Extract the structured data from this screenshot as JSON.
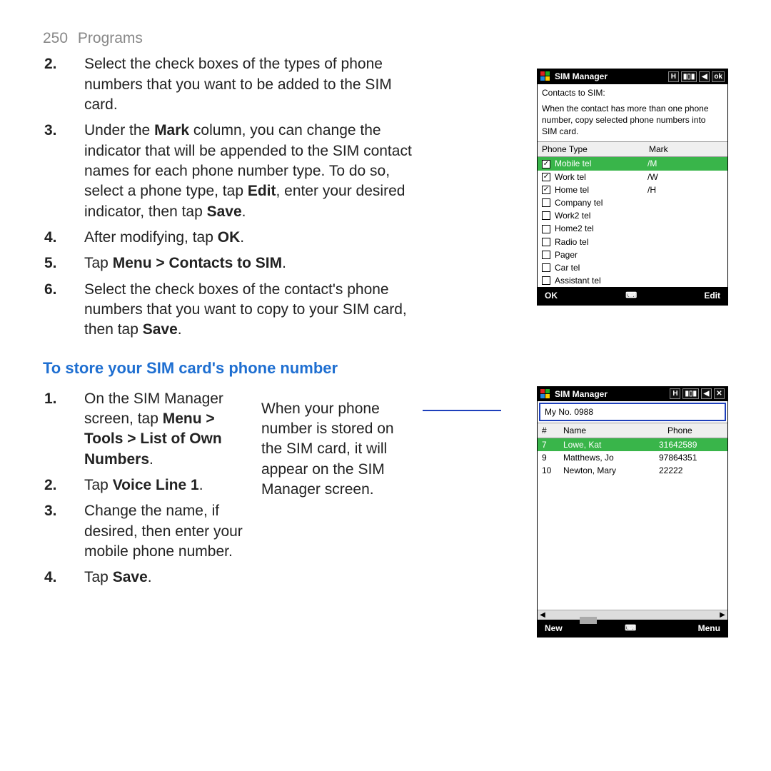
{
  "header": {
    "page_number": "250",
    "chapter": "Programs"
  },
  "steps_top": {
    "s2": {
      "n": "2.",
      "text_a": "Select the check boxes of the types of phone numbers that you want to be added to the SIM card."
    },
    "s3": {
      "n": "3.",
      "text_a": "Under the ",
      "b1": "Mark",
      "text_b": " column, you can change the indicator that will be appended to the SIM contact names for each phone number type. To do so, select a phone type, tap ",
      "b2": "Edit",
      "text_c": ", enter your desired indicator, then tap ",
      "b3": "Save",
      "text_d": "."
    },
    "s4": {
      "n": "4.",
      "text_a": "After modifying, tap ",
      "b1": "OK",
      "text_b": "."
    },
    "s5": {
      "n": "5.",
      "text_a": "Tap ",
      "b1": "Menu > Contacts to SIM",
      "text_b": "."
    },
    "s6": {
      "n": "6.",
      "text_a": "Select the check boxes of the contact's phone numbers that you want to copy to your SIM card, then tap ",
      "b1": "Save",
      "text_b": "."
    }
  },
  "section_h": "To store your SIM card's phone number",
  "steps_low": {
    "s1": {
      "n": "1.",
      "text_a": "On the SIM Manager screen, tap ",
      "b1": "Menu > Tools > List of Own Numbers",
      "text_b": "."
    },
    "s2": {
      "n": "2.",
      "text_a": "Tap ",
      "b1": "Voice Line 1",
      "text_b": "."
    },
    "s3": {
      "n": "3.",
      "text_a": "Change the name, if desired, then enter your mobile phone number."
    },
    "s4": {
      "n": "4.",
      "text_a": "Tap ",
      "b1": "Save",
      "text_b": "."
    }
  },
  "mid_note": "When your phone number is stored on the SIM card, it will appear on the SIM Manager screen.",
  "phone1": {
    "title": "SIM Manager",
    "icons": {
      "h": "H",
      "signal": "▮▯▮",
      "sound": "◀",
      "ok": "ok"
    },
    "subtitle": "Contacts to SIM:",
    "desc": "When the contact has more than one phone number, copy selected phone numbers into SIM card.",
    "headers": {
      "type": "Phone Type",
      "mark": "Mark"
    },
    "rows": [
      {
        "label": "Mobile tel",
        "mark": "/M",
        "checked": true,
        "selected": true
      },
      {
        "label": "Work tel",
        "mark": "/W",
        "checked": true,
        "selected": false
      },
      {
        "label": "Home tel",
        "mark": "/H",
        "checked": true,
        "selected": false
      },
      {
        "label": "Company tel",
        "mark": "",
        "checked": false,
        "selected": false
      },
      {
        "label": "Work2 tel",
        "mark": "",
        "checked": false,
        "selected": false
      },
      {
        "label": "Home2 tel",
        "mark": "",
        "checked": false,
        "selected": false
      },
      {
        "label": "Radio tel",
        "mark": "",
        "checked": false,
        "selected": false
      },
      {
        "label": "Pager",
        "mark": "",
        "checked": false,
        "selected": false
      },
      {
        "label": "Car tel",
        "mark": "",
        "checked": false,
        "selected": false
      },
      {
        "label": "Assistant tel",
        "mark": "",
        "checked": false,
        "selected": false
      }
    ],
    "menu": {
      "left": "OK",
      "mid": "⌨",
      "right": "Edit"
    }
  },
  "phone2": {
    "title": "SIM Manager",
    "icons": {
      "h": "H",
      "signal": "▮▯▮",
      "sound": "◀",
      "close": "✕"
    },
    "my_number": "My No. 0988",
    "headers": {
      "num": "#",
      "name": "Name",
      "phone": "Phone"
    },
    "rows": [
      {
        "num": "7",
        "name": "Lowe, Kat",
        "phone": "31642589",
        "selected": true
      },
      {
        "num": "9",
        "name": "Matthews, Jo",
        "phone": "97864351",
        "selected": false
      },
      {
        "num": "10",
        "name": "Newton, Mary",
        "phone": "22222",
        "selected": false
      }
    ],
    "scroll": {
      "left": "◀",
      "right": "▶"
    },
    "menu": {
      "left": "New",
      "mid": "⌨",
      "right": "Menu"
    }
  }
}
